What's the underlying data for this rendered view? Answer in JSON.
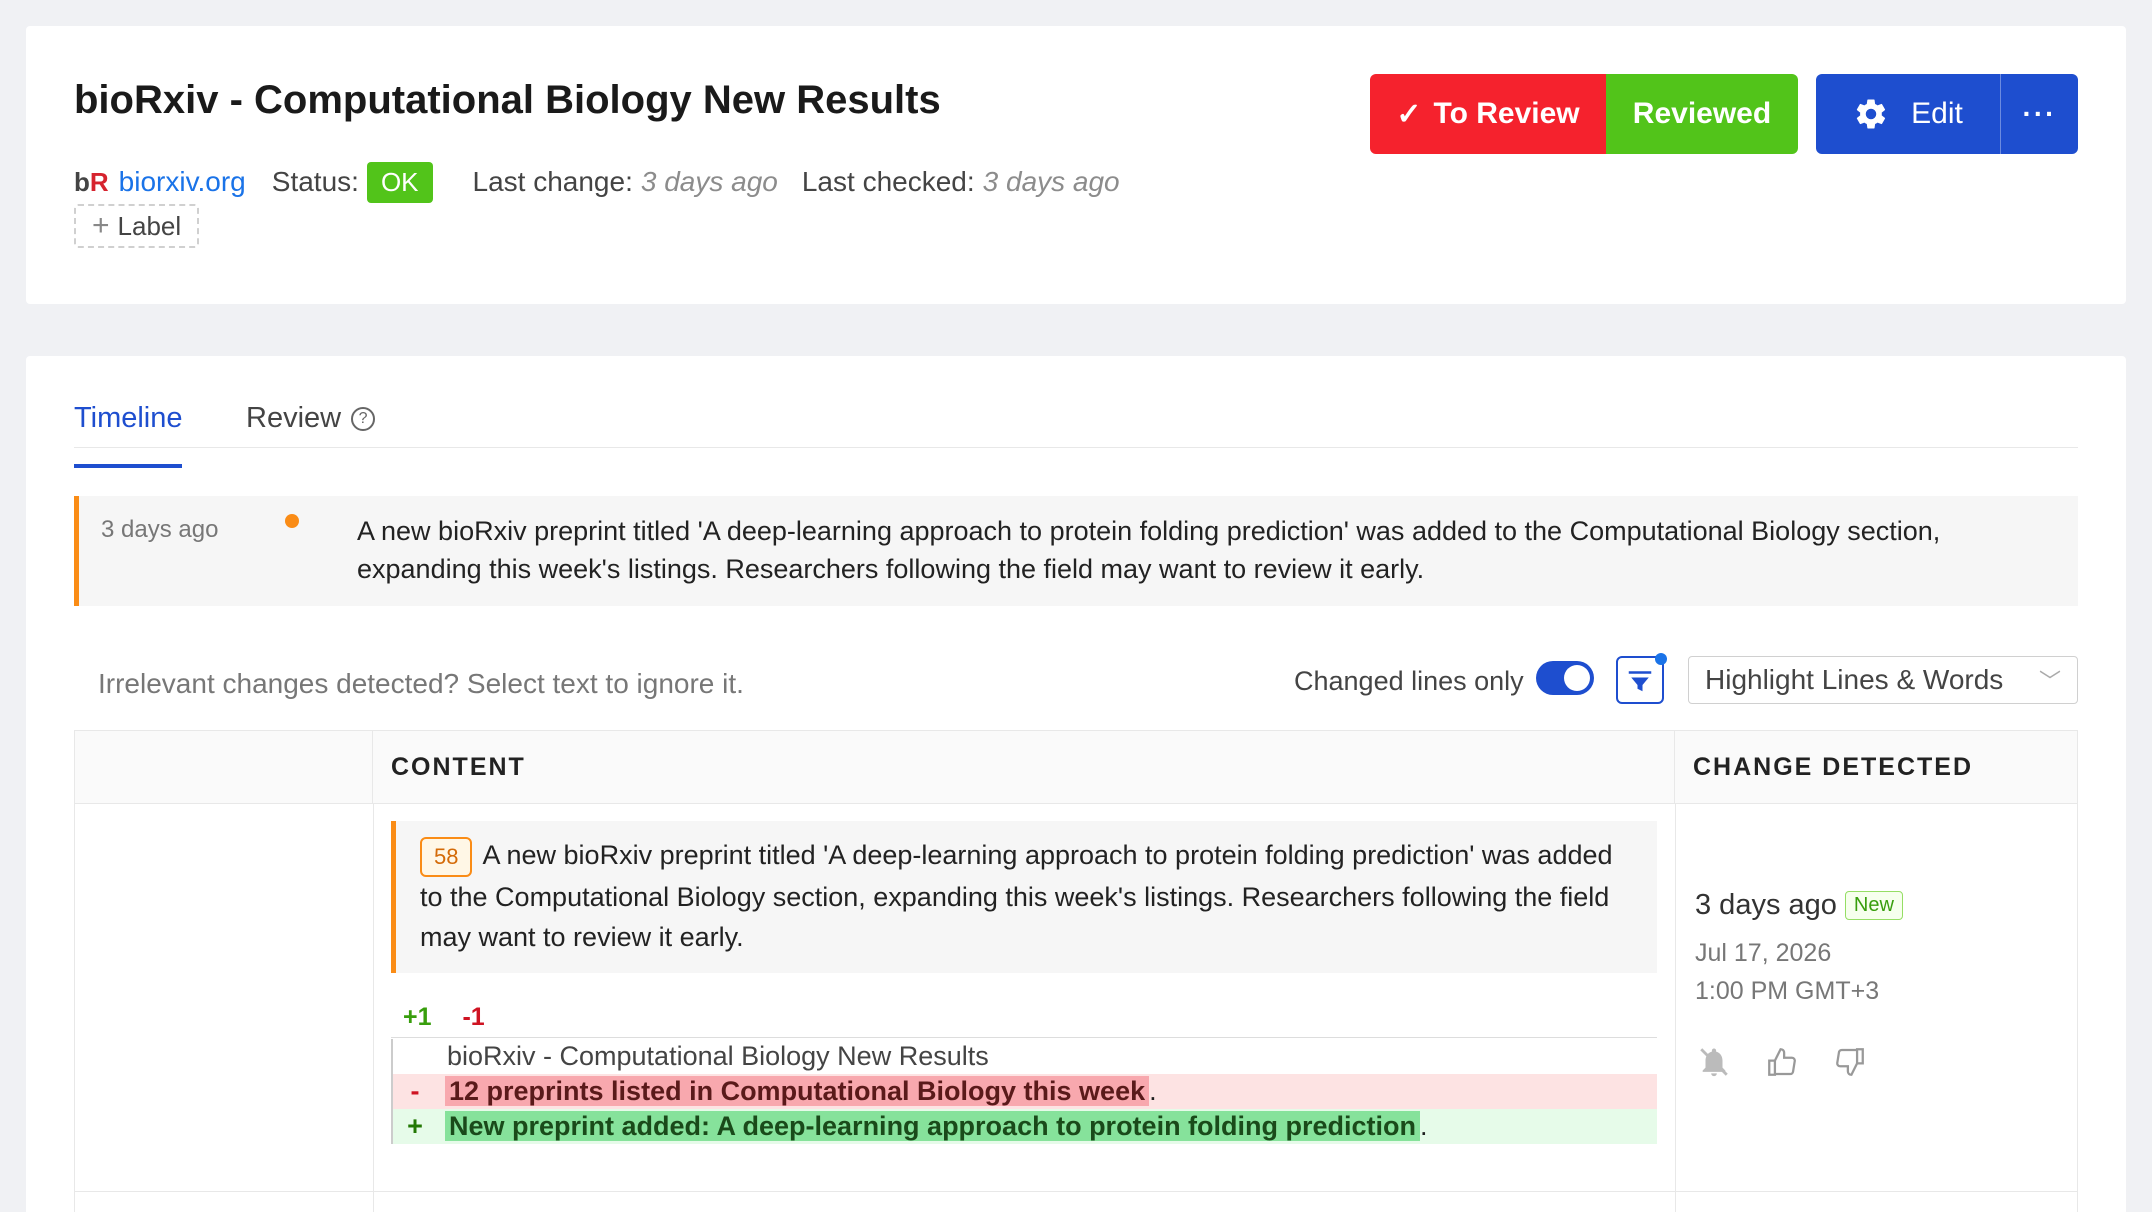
{
  "header": {
    "title": "bioRxiv - Computational Biology New Results",
    "logo_b": "b",
    "logo_r": "R",
    "site": "biorxiv.org",
    "status_label": "Status:",
    "status_value": "OK",
    "last_change_label": "Last change:",
    "last_change_value": "3 days ago",
    "last_checked_label": "Last checked:",
    "last_checked_value": "3 days ago",
    "label_button": "Label",
    "to_review_button": "To Review",
    "reviewed_button": "Reviewed",
    "edit_button": "Edit",
    "more_button": "···"
  },
  "tabs": [
    {
      "label": "Timeline",
      "active": true
    },
    {
      "label": "Review",
      "active": false
    }
  ],
  "timeline_entry": {
    "time": "3 days ago",
    "text": "A new bioRxiv preprint titled 'A deep-learning approach to protein folding prediction' was added to the Computational Biology section, expanding this week's listings. Researchers following the field may want to review it early."
  },
  "toolbar": {
    "hint": "Irrelevant changes detected? Select text to ignore it.",
    "changed_lines_label": "Changed lines only",
    "changed_lines_on": true,
    "highlight_select": "Highlight Lines & Words"
  },
  "table": {
    "headers": {
      "content": "CONTENT",
      "change_detected": "CHANGE DETECTED"
    },
    "row": {
      "line_badge": "58",
      "summary": "A new bioRxiv preprint titled 'A deep-learning approach to protein folding prediction' was added to the Computational Biology section, expanding this week's listings. Researchers following the field may want to review it early.",
      "additions": "+1",
      "deletions": "-1",
      "diff": {
        "context": "bioRxiv - Computational Biology New Results",
        "removed_sign": "-",
        "removed": "12 preprints listed in Computational Biology this week",
        "removed_suffix": ".",
        "added_sign": "+",
        "added": "New preprint added: A deep-learning approach to protein folding prediction",
        "added_suffix": "."
      },
      "change_when": "3 days ago",
      "new_tag": "New",
      "change_date": "Jul 17, 2026",
      "change_time": "1:00 PM GMT+3"
    }
  },
  "colors": {
    "accent": "#1e4ecf",
    "to_review": "#f5222d",
    "reviewed": "#52c41a",
    "warning": "#fa8c16"
  }
}
